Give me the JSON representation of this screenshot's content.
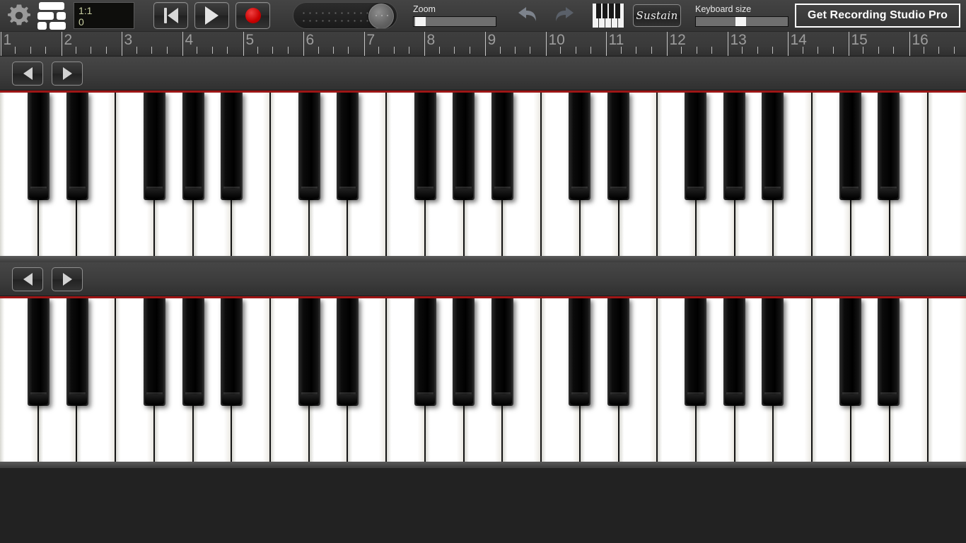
{
  "app": {
    "title": "Recording Studio — Virtual Piano",
    "background_color": "#222222"
  },
  "toolbar": {
    "settings_icon": "gear-icon",
    "layout_icon": "grid-layout-icon",
    "lcd": {
      "position": "1:1",
      "value": "0"
    },
    "transport": {
      "rewind_label": "Rewind to start",
      "play_label": "Play",
      "record_label": "Record"
    },
    "tempo_knob_label": "Tempo",
    "zoom": {
      "label": "Zoom",
      "value_percent": 2
    },
    "undo_label": "Undo",
    "redo_label": "Redo",
    "keyboard_icon": "piano-keys-icon",
    "sustain_label": "Sustain",
    "keyboard_size": {
      "label": "Keyboard size",
      "value_percent": 48
    },
    "pro_button_label": "Get Recording Studio Pro",
    "accent_color": "#c21a1a",
    "lcd_text_color": "#c9cfa2"
  },
  "ruler": {
    "bars": [
      "1",
      "2",
      "3",
      "4",
      "5",
      "6",
      "7",
      "8",
      "9",
      "10",
      "11",
      "12",
      "13",
      "14",
      "15",
      "16"
    ],
    "subdivisions_per_bar": 4,
    "playhead_bar": "1"
  },
  "keyboards": [
    {
      "name": "upper-keyboard",
      "scroll_left_label": "Scroll octave left",
      "scroll_right_label": "Scroll octave right",
      "white_key_count": 25,
      "white_keys": [
        "C",
        "D",
        "E",
        "F",
        "G",
        "A",
        "B",
        "C",
        "D",
        "E",
        "F",
        "G",
        "A",
        "B",
        "C",
        "D",
        "E",
        "F",
        "G",
        "A",
        "B",
        "C",
        "D",
        "E",
        "F"
      ],
      "black_keys": [
        "C#",
        "D#",
        "F#",
        "G#",
        "A#",
        "C#",
        "D#",
        "F#",
        "G#",
        "A#",
        "C#",
        "D#",
        "F#",
        "G#",
        "A#",
        "C#",
        "D#"
      ],
      "black_key_slots": [
        0,
        1,
        3,
        4,
        5,
        7,
        8,
        10,
        11,
        12,
        14,
        15,
        17,
        18,
        19,
        21,
        22
      ]
    },
    {
      "name": "lower-keyboard",
      "scroll_left_label": "Scroll octave left",
      "scroll_right_label": "Scroll octave right",
      "white_key_count": 25,
      "white_keys": [
        "C",
        "D",
        "E",
        "F",
        "G",
        "A",
        "B",
        "C",
        "D",
        "E",
        "F",
        "G",
        "A",
        "B",
        "C",
        "D",
        "E",
        "F",
        "G",
        "A",
        "B",
        "C",
        "D",
        "E",
        "F"
      ],
      "black_keys": [
        "C#",
        "D#",
        "F#",
        "G#",
        "A#",
        "C#",
        "D#",
        "F#",
        "G#",
        "A#",
        "C#",
        "D#",
        "F#",
        "G#",
        "A#",
        "C#",
        "D#"
      ],
      "black_key_slots": [
        0,
        1,
        3,
        4,
        5,
        7,
        8,
        10,
        11,
        12,
        14,
        15,
        17,
        18,
        19,
        21,
        22
      ]
    }
  ]
}
